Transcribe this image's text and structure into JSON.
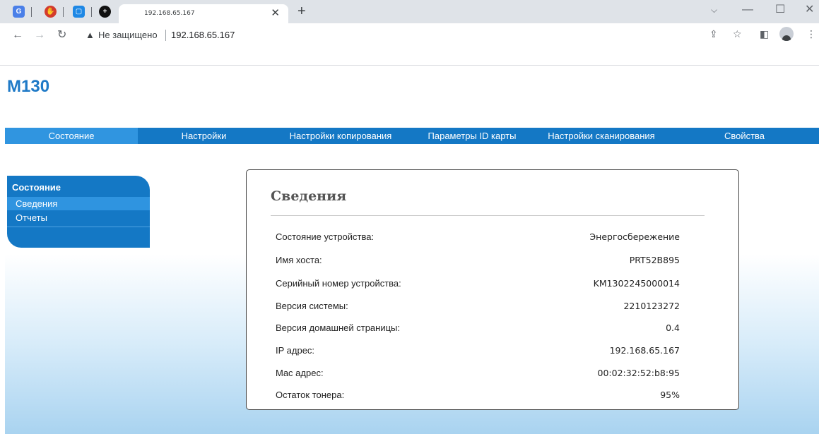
{
  "browser": {
    "tab_title": "192.168.65.167",
    "security_label": "Не защищено",
    "url": "192.168.65.167"
  },
  "page": {
    "logo": "M130",
    "menu": [
      {
        "label": "Состояние",
        "active": true
      },
      {
        "label": "Настройки",
        "active": false
      },
      {
        "label": "Настройки копирования",
        "active": false
      },
      {
        "label": "Параметры ID карты",
        "active": false
      },
      {
        "label": "Настройки сканирования",
        "active": false
      },
      {
        "label": "Свойства",
        "active": false
      }
    ],
    "sidebar": {
      "heading": "Состояние",
      "items": [
        {
          "label": "Сведения",
          "selected": true
        },
        {
          "label": "Отчеты",
          "selected": false
        }
      ]
    },
    "info_panel": {
      "title": "Сведения",
      "rows": [
        {
          "key": "Состояние устройства:",
          "value": "Энергосбережение"
        },
        {
          "key": "Имя хоста:",
          "value": "PRT52B895"
        },
        {
          "key": "Серийный номер устройства:",
          "value": "KM1302245000014"
        },
        {
          "key": "Версия системы:",
          "value": "2210123272"
        },
        {
          "key": "Версия домашней страницы:",
          "value": "0.4"
        },
        {
          "key": "IP адрес:",
          "value": "192.168.65.167"
        },
        {
          "key": "Mac адрес:",
          "value": "00:02:32:52:b8:95"
        },
        {
          "key": "Остаток тонера:",
          "value": "95%"
        }
      ]
    }
  },
  "colors": {
    "brand_blue": "#1478c5",
    "menu_active": "#3095e0",
    "logo_blue": "#1f7ac7"
  }
}
